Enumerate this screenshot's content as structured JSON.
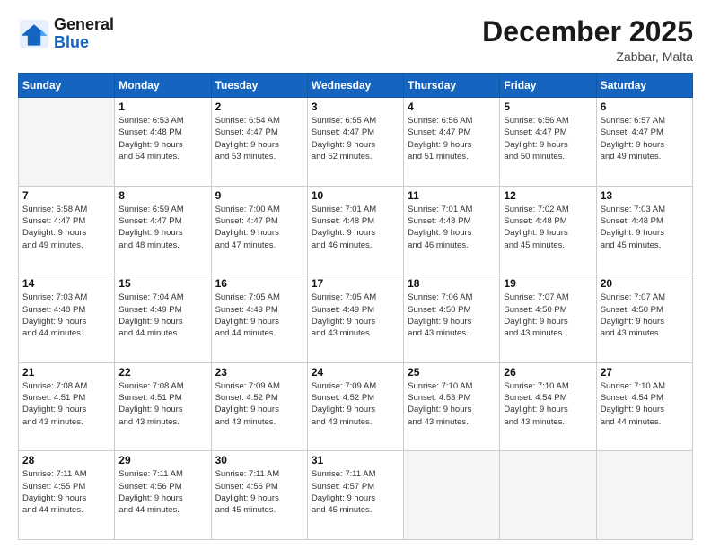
{
  "header": {
    "logo_line1": "General",
    "logo_line2": "Blue",
    "month": "December 2025",
    "location": "Zabbar, Malta"
  },
  "weekdays": [
    "Sunday",
    "Monday",
    "Tuesday",
    "Wednesday",
    "Thursday",
    "Friday",
    "Saturday"
  ],
  "weeks": [
    [
      {
        "day": "",
        "empty": true
      },
      {
        "day": "1",
        "sunrise": "6:53 AM",
        "sunset": "4:48 PM",
        "daylight": "9 hours and 54 minutes."
      },
      {
        "day": "2",
        "sunrise": "6:54 AM",
        "sunset": "4:47 PM",
        "daylight": "9 hours and 53 minutes."
      },
      {
        "day": "3",
        "sunrise": "6:55 AM",
        "sunset": "4:47 PM",
        "daylight": "9 hours and 52 minutes."
      },
      {
        "day": "4",
        "sunrise": "6:56 AM",
        "sunset": "4:47 PM",
        "daylight": "9 hours and 51 minutes."
      },
      {
        "day": "5",
        "sunrise": "6:56 AM",
        "sunset": "4:47 PM",
        "daylight": "9 hours and 50 minutes."
      },
      {
        "day": "6",
        "sunrise": "6:57 AM",
        "sunset": "4:47 PM",
        "daylight": "9 hours and 49 minutes."
      }
    ],
    [
      {
        "day": "7",
        "sunrise": "6:58 AM",
        "sunset": "4:47 PM",
        "daylight": "9 hours and 49 minutes."
      },
      {
        "day": "8",
        "sunrise": "6:59 AM",
        "sunset": "4:47 PM",
        "daylight": "9 hours and 48 minutes."
      },
      {
        "day": "9",
        "sunrise": "7:00 AM",
        "sunset": "4:47 PM",
        "daylight": "9 hours and 47 minutes."
      },
      {
        "day": "10",
        "sunrise": "7:01 AM",
        "sunset": "4:48 PM",
        "daylight": "9 hours and 46 minutes."
      },
      {
        "day": "11",
        "sunrise": "7:01 AM",
        "sunset": "4:48 PM",
        "daylight": "9 hours and 46 minutes."
      },
      {
        "day": "12",
        "sunrise": "7:02 AM",
        "sunset": "4:48 PM",
        "daylight": "9 hours and 45 minutes."
      },
      {
        "day": "13",
        "sunrise": "7:03 AM",
        "sunset": "4:48 PM",
        "daylight": "9 hours and 45 minutes."
      }
    ],
    [
      {
        "day": "14",
        "sunrise": "7:03 AM",
        "sunset": "4:48 PM",
        "daylight": "9 hours and 44 minutes."
      },
      {
        "day": "15",
        "sunrise": "7:04 AM",
        "sunset": "4:49 PM",
        "daylight": "9 hours and 44 minutes."
      },
      {
        "day": "16",
        "sunrise": "7:05 AM",
        "sunset": "4:49 PM",
        "daylight": "9 hours and 44 minutes."
      },
      {
        "day": "17",
        "sunrise": "7:05 AM",
        "sunset": "4:49 PM",
        "daylight": "9 hours and 43 minutes."
      },
      {
        "day": "18",
        "sunrise": "7:06 AM",
        "sunset": "4:50 PM",
        "daylight": "9 hours and 43 minutes."
      },
      {
        "day": "19",
        "sunrise": "7:07 AM",
        "sunset": "4:50 PM",
        "daylight": "9 hours and 43 minutes."
      },
      {
        "day": "20",
        "sunrise": "7:07 AM",
        "sunset": "4:50 PM",
        "daylight": "9 hours and 43 minutes."
      }
    ],
    [
      {
        "day": "21",
        "sunrise": "7:08 AM",
        "sunset": "4:51 PM",
        "daylight": "9 hours and 43 minutes."
      },
      {
        "day": "22",
        "sunrise": "7:08 AM",
        "sunset": "4:51 PM",
        "daylight": "9 hours and 43 minutes."
      },
      {
        "day": "23",
        "sunrise": "7:09 AM",
        "sunset": "4:52 PM",
        "daylight": "9 hours and 43 minutes."
      },
      {
        "day": "24",
        "sunrise": "7:09 AM",
        "sunset": "4:52 PM",
        "daylight": "9 hours and 43 minutes."
      },
      {
        "day": "25",
        "sunrise": "7:10 AM",
        "sunset": "4:53 PM",
        "daylight": "9 hours and 43 minutes."
      },
      {
        "day": "26",
        "sunrise": "7:10 AM",
        "sunset": "4:54 PM",
        "daylight": "9 hours and 43 minutes."
      },
      {
        "day": "27",
        "sunrise": "7:10 AM",
        "sunset": "4:54 PM",
        "daylight": "9 hours and 44 minutes."
      }
    ],
    [
      {
        "day": "28",
        "sunrise": "7:11 AM",
        "sunset": "4:55 PM",
        "daylight": "9 hours and 44 minutes."
      },
      {
        "day": "29",
        "sunrise": "7:11 AM",
        "sunset": "4:56 PM",
        "daylight": "9 hours and 44 minutes."
      },
      {
        "day": "30",
        "sunrise": "7:11 AM",
        "sunset": "4:56 PM",
        "daylight": "9 hours and 45 minutes."
      },
      {
        "day": "31",
        "sunrise": "7:11 AM",
        "sunset": "4:57 PM",
        "daylight": "9 hours and 45 minutes."
      },
      {
        "day": "",
        "empty": true
      },
      {
        "day": "",
        "empty": true
      },
      {
        "day": "",
        "empty": true
      }
    ]
  ],
  "labels": {
    "sunrise": "Sunrise:",
    "sunset": "Sunset:",
    "daylight": "Daylight:"
  }
}
